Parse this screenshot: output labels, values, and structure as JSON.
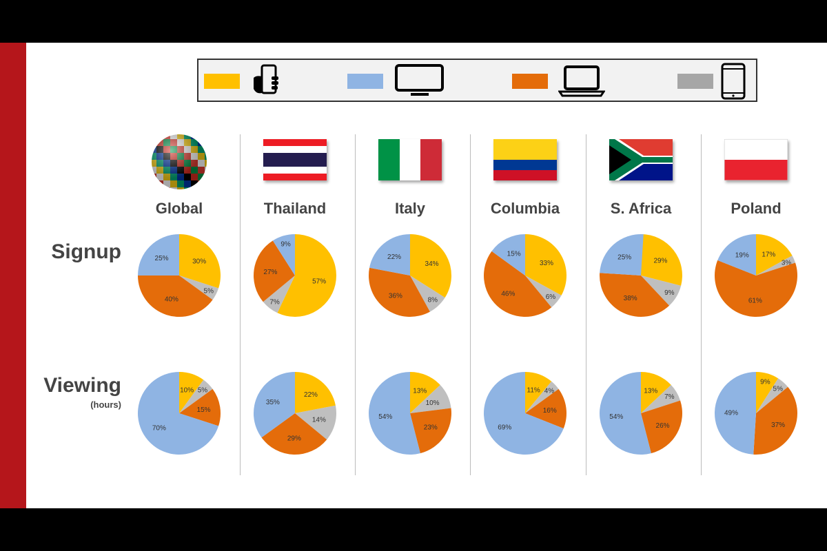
{
  "legend": [
    {
      "device": "smartphone",
      "icon": "hand-holding-phone-icon",
      "color": "#ffc000"
    },
    {
      "device": "tv",
      "icon": "tv-icon",
      "color": "#8fb4e3"
    },
    {
      "device": "laptop",
      "icon": "laptop-icon",
      "color": "#e46c0a"
    },
    {
      "device": "tablet",
      "icon": "tablet-icon",
      "color": "#a6a6a6"
    }
  ],
  "row_labels": {
    "signup": "Signup",
    "viewing": "Viewing",
    "viewing_sub": "(hours)"
  },
  "chart_data": {
    "type": "pie",
    "slice_order": [
      "smartphone",
      "tablet",
      "laptop",
      "tv"
    ],
    "slice_colors": [
      "#ffc000",
      "#bfbfbf",
      "#e46c0a",
      "#8fb4e3"
    ],
    "columns": [
      {
        "name": "Global",
        "flag": "globe",
        "signup": [
          30,
          5,
          40,
          25
        ],
        "viewing": [
          10,
          5,
          15,
          70
        ]
      },
      {
        "name": "Thailand",
        "flag": "thailand",
        "signup": [
          57,
          7,
          27,
          9
        ],
        "viewing": [
          22,
          14,
          29,
          35
        ]
      },
      {
        "name": "Italy",
        "flag": "italy",
        "signup": [
          34,
          8,
          36,
          22
        ],
        "viewing": [
          13,
          10,
          23,
          54
        ]
      },
      {
        "name": "Columbia",
        "flag": "colombia",
        "signup": [
          33,
          6,
          46,
          15
        ],
        "viewing": [
          11,
          4,
          16,
          69
        ]
      },
      {
        "name": "S. Africa",
        "flag": "south-africa",
        "signup": [
          29,
          9,
          38,
          25
        ],
        "viewing": [
          13,
          7,
          26,
          54
        ]
      },
      {
        "name": "Poland",
        "flag": "poland",
        "signup": [
          17,
          3,
          61,
          19
        ],
        "viewing": [
          9,
          5,
          37,
          49
        ]
      }
    ]
  }
}
